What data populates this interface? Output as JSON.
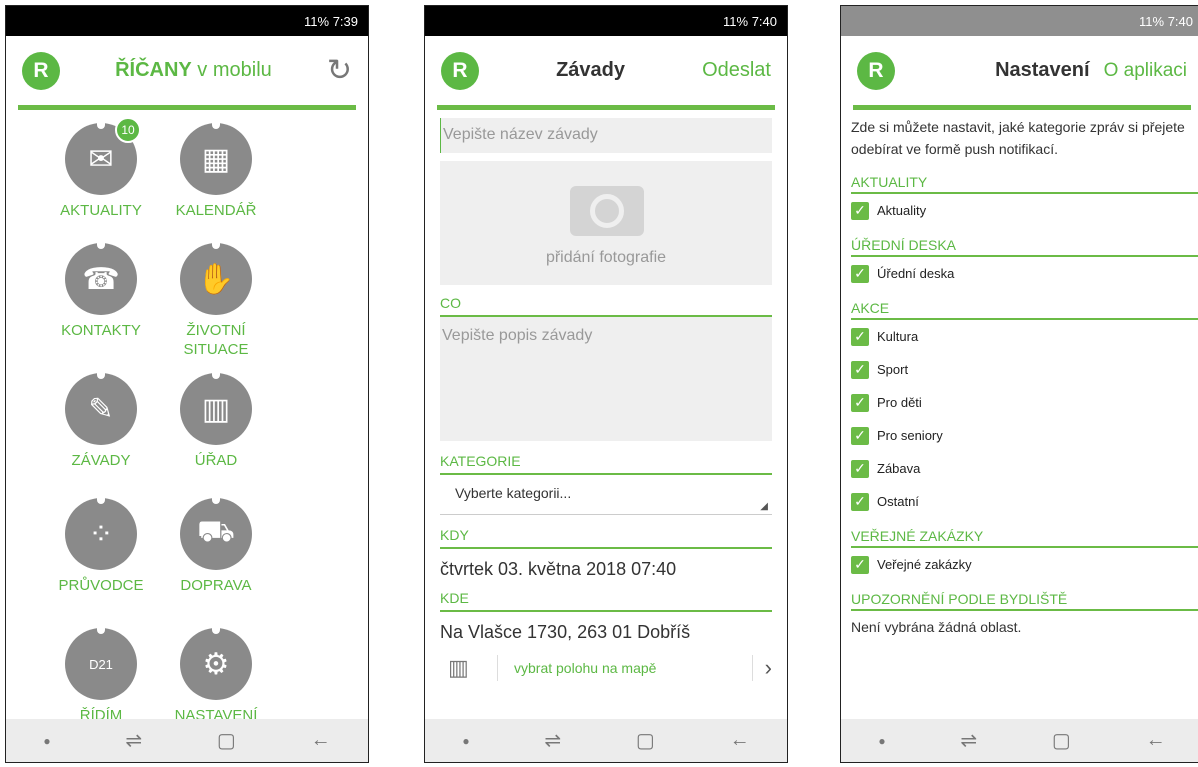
{
  "screen1": {
    "status": "11% 7:39",
    "logo": "R",
    "title_bold": "ŘÍČANY",
    "title_rest": " v mobilu",
    "badge": "10",
    "tiles": [
      {
        "label": "AKTUALITY",
        "icon": "envelope-icon",
        "glyph": "✉"
      },
      {
        "label": "KALENDÁŘ",
        "icon": "calendar-icon",
        "glyph": "▦"
      },
      {
        "label": "KONTAKTY",
        "icon": "phone-icon",
        "glyph": "☎"
      },
      {
        "label": "ŽIVOTNÍ SITUACE",
        "icon": "hand-icon",
        "glyph": "✋"
      },
      {
        "label": "ZÁVADY",
        "icon": "wrench-icon",
        "glyph": "✎"
      },
      {
        "label": "ÚŘAD",
        "icon": "building-icon",
        "glyph": "▥"
      },
      {
        "label": "PRŮVODCE",
        "icon": "footprints-icon",
        "glyph": "⁘"
      },
      {
        "label": "DOPRAVA",
        "icon": "car-icon",
        "glyph": "⛟"
      },
      {
        "label": "ŘÍDÍM",
        "icon": "d21-icon",
        "glyph": "D21"
      },
      {
        "label": "NASTAVENÍ",
        "icon": "gears-icon",
        "glyph": "⚙"
      }
    ]
  },
  "screen2": {
    "status": "11% 7:40",
    "logo": "R",
    "title": "Závady",
    "action": "Odeslat",
    "name_placeholder": "Vepište název závady",
    "photo_label": "přidání fotografie",
    "co_label": "CO",
    "desc_placeholder": "Vepište popis závady",
    "kategorie_label": "KATEGORIE",
    "kategorie_value": "Vyberte kategorii...",
    "kdy_label": "KDY",
    "kdy_value": "čtvrtek 03. května 2018 07:40",
    "kde_label": "KDE",
    "kde_value": "Na Vlašce 1730, 263 01 Dobříš",
    "map_link": "vybrat polohu na mapě"
  },
  "screen3": {
    "status": "11% 7:40",
    "logo": "R",
    "title": "Nastavení",
    "action": "O aplikaci",
    "intro": "Zde si můžete nastavit, jaké kategorie zpráv si přejete odebírat ve formě push notifikací.",
    "sections": [
      {
        "title": "AKTUALITY",
        "items": [
          "Aktuality"
        ]
      },
      {
        "title": "ÚŘEDNÍ DESKA",
        "items": [
          "Úřední deska"
        ]
      },
      {
        "title": "AKCE",
        "items": [
          "Kultura",
          "Sport",
          "Pro děti",
          "Pro seniory",
          "Zábava",
          "Ostatní"
        ]
      },
      {
        "title": "VEŘEJNÉ ZAKÁZKY",
        "items": [
          "Veřejné zakázky"
        ]
      },
      {
        "title": "UPOZORNĚNÍ PODLE BYDLIŠTĚ",
        "items": []
      }
    ],
    "no_area": "Není vybrána žádná oblast."
  },
  "colors": {
    "accent": "#5cb844",
    "icon_gray": "#8a8a8a"
  }
}
